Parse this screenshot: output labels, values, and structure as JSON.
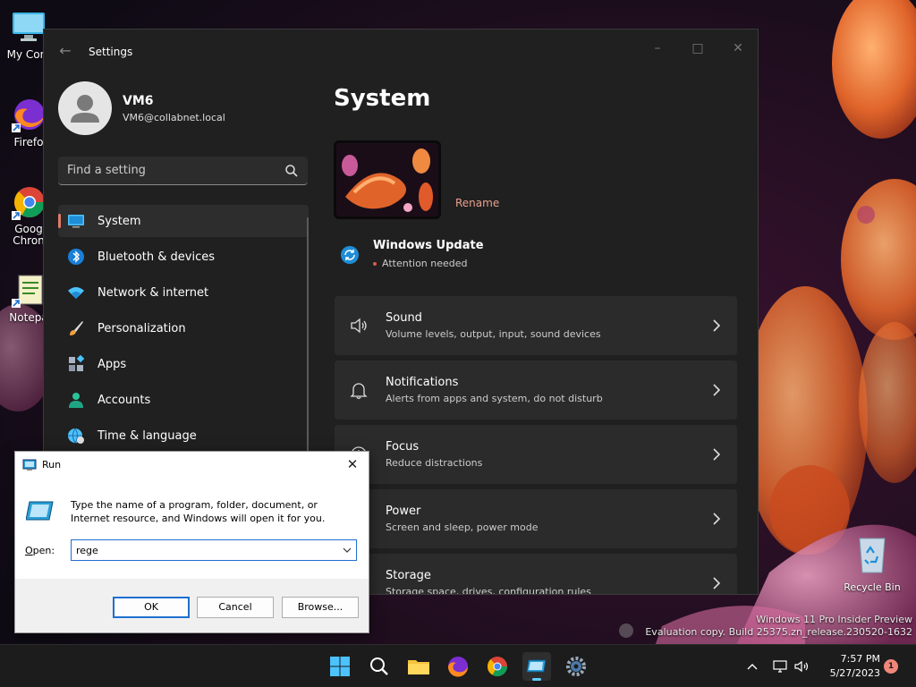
{
  "desktop": {
    "icons": [
      {
        "label": "My Com",
        "icon": "computer-icon"
      },
      {
        "label": "Firefo",
        "icon": "firefox-icon"
      },
      {
        "label": "Goog\nChron",
        "icon": "chrome-icon"
      },
      {
        "label": "Notepa",
        "icon": "notepad-icon"
      }
    ],
    "recycle_bin": "Recycle Bin",
    "watermark_line1": "Windows 11 Pro Insider Preview",
    "watermark_line2": "Evaluation copy. Build 25375.zn_release.230520-1632"
  },
  "settings": {
    "window_title": "Settings",
    "user": {
      "name": "VM6",
      "email": "VM6@collabnet.local"
    },
    "search_placeholder": "Find a setting",
    "nav": [
      {
        "label": "System",
        "icon": "monitor-icon",
        "active": true
      },
      {
        "label": "Bluetooth & devices",
        "icon": "bluetooth-icon"
      },
      {
        "label": "Network & internet",
        "icon": "wifi-icon"
      },
      {
        "label": "Personalization",
        "icon": "brush-icon"
      },
      {
        "label": "Apps",
        "icon": "apps-icon"
      },
      {
        "label": "Accounts",
        "icon": "person-icon"
      },
      {
        "label": "Time & language",
        "icon": "globe-clock-icon"
      }
    ],
    "page_title": "System",
    "rename_label": "Rename",
    "windows_update": {
      "title": "Windows Update",
      "status": "Attention needed"
    },
    "cards": [
      {
        "title": "Sound",
        "subtitle": "Volume levels, output, input, sound devices",
        "icon": "speaker-icon"
      },
      {
        "title": "Notifications",
        "subtitle": "Alerts from apps and system, do not disturb",
        "icon": "bell-icon"
      },
      {
        "title": "Focus",
        "subtitle": "Reduce distractions",
        "icon": "focus-icon"
      },
      {
        "title": "Power",
        "subtitle": "Screen and sleep, power mode",
        "icon": "power-icon"
      },
      {
        "title": "Storage",
        "subtitle": "Storage space, drives, configuration rules",
        "icon": "storage-icon"
      }
    ]
  },
  "run_dialog": {
    "title": "Run",
    "description": "Type the name of a program, folder, document, or Internet resource, and Windows will open it for you.",
    "open_label_prefix": "",
    "open_label_key": "O",
    "open_label_rest": "pen:",
    "input_value": "rege",
    "ok_label": "OK",
    "cancel_label": "Cancel",
    "browse_label": "Browse..."
  },
  "taskbar": {
    "time": "7:57 PM",
    "date": "5/27/2023",
    "notification_count": "1"
  },
  "colors": {
    "accent": "#60cdff",
    "nav_active_pill": "#e07b6a",
    "run_focus": "#1e6fd0",
    "settings_bg": "#202020",
    "card_bg": "#2b2b2b"
  }
}
